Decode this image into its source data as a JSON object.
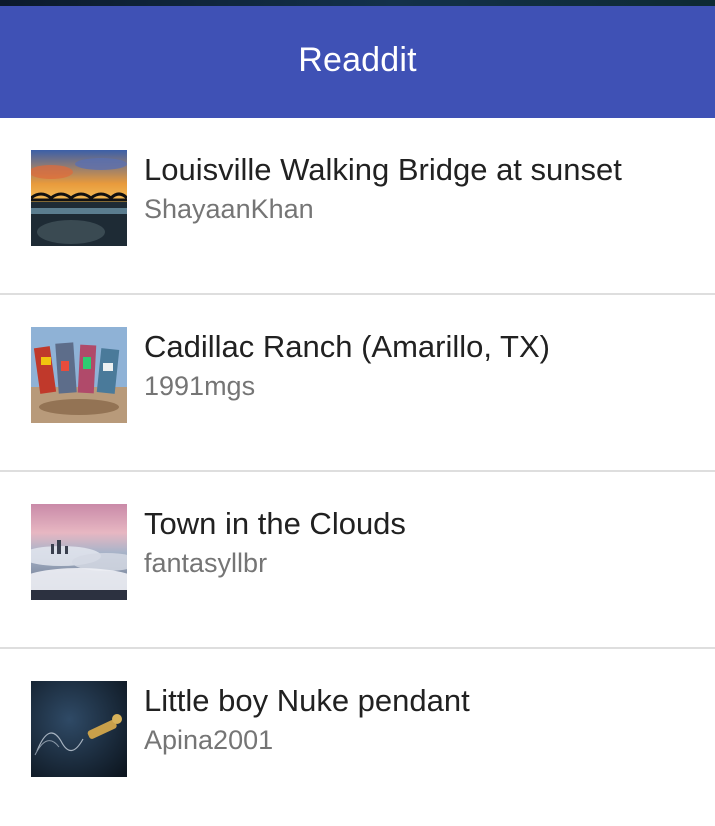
{
  "app": {
    "title": "Readdit",
    "colors": {
      "app_bar": "#3f51b5",
      "title_text": "#212121",
      "author_text": "#757575"
    }
  },
  "posts": [
    {
      "title": "Louisville Walking Bridge at sunset",
      "author": "ShayaanKhan",
      "thumbnail": "bridge-sunset-photo"
    },
    {
      "title": "Cadillac Ranch (Amarillo, TX)",
      "author": "1991mgs",
      "thumbnail": "cadillac-ranch-photo"
    },
    {
      "title": "Town in the Clouds",
      "author": "fantasyllbr",
      "thumbnail": "town-clouds-photo"
    },
    {
      "title": "Little boy Nuke pendant",
      "author": "Apina2001",
      "thumbnail": "nuke-pendant-photo"
    }
  ]
}
